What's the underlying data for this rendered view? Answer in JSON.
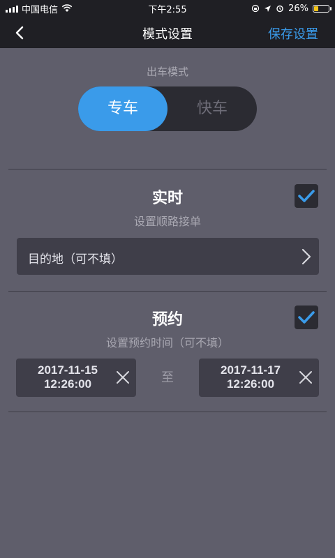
{
  "status_bar": {
    "carrier": "中国电信",
    "time": "下午2:55",
    "battery": "26%",
    "battery_level": 0.26,
    "icons": [
      "signal-icon",
      "wifi-icon",
      "rotation-lock-icon",
      "location-arrow-icon",
      "alarm-icon",
      "battery-icon"
    ]
  },
  "nav": {
    "back_icon": "chevron-left-icon",
    "title": "模式设置",
    "save_label": "保存设置"
  },
  "mode": {
    "label": "出车模式",
    "options": [
      "专车",
      "快车"
    ],
    "selected": "专车"
  },
  "realtime": {
    "title": "实时",
    "subtitle": "设置顺路接单",
    "checked": true,
    "destination_placeholder": "目的地（可不填）"
  },
  "reservation": {
    "title": "预约",
    "subtitle": "设置预约时间（可不填）",
    "checked": true,
    "start_date": "2017-11-15",
    "start_time": "12:26:00",
    "to_label": "至",
    "end_date": "2017-11-17",
    "end_time": "12:26:00"
  },
  "colors": {
    "accent": "#3a9bea",
    "background": "#5f5e6b",
    "bar": "#1f1f24",
    "panel": "#3f3e49"
  }
}
